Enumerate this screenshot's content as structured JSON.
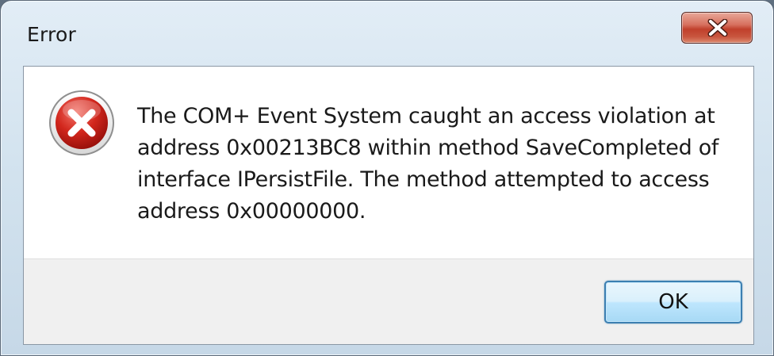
{
  "dialog": {
    "title": "Error",
    "message": "The COM+ Event System caught an access violation at address 0x00213BC8 within method SaveCompleted of interface IPersistFile. The method attempted to access address 0x00000000.",
    "ok_label": "OK"
  },
  "icons": {
    "error": "error-icon",
    "close": "close-icon"
  },
  "colors": {
    "error_red": "#c8231b",
    "close_button": "#c9563f",
    "ok_border": "#3c7fb1",
    "button_panel": "#f0f0f0"
  }
}
